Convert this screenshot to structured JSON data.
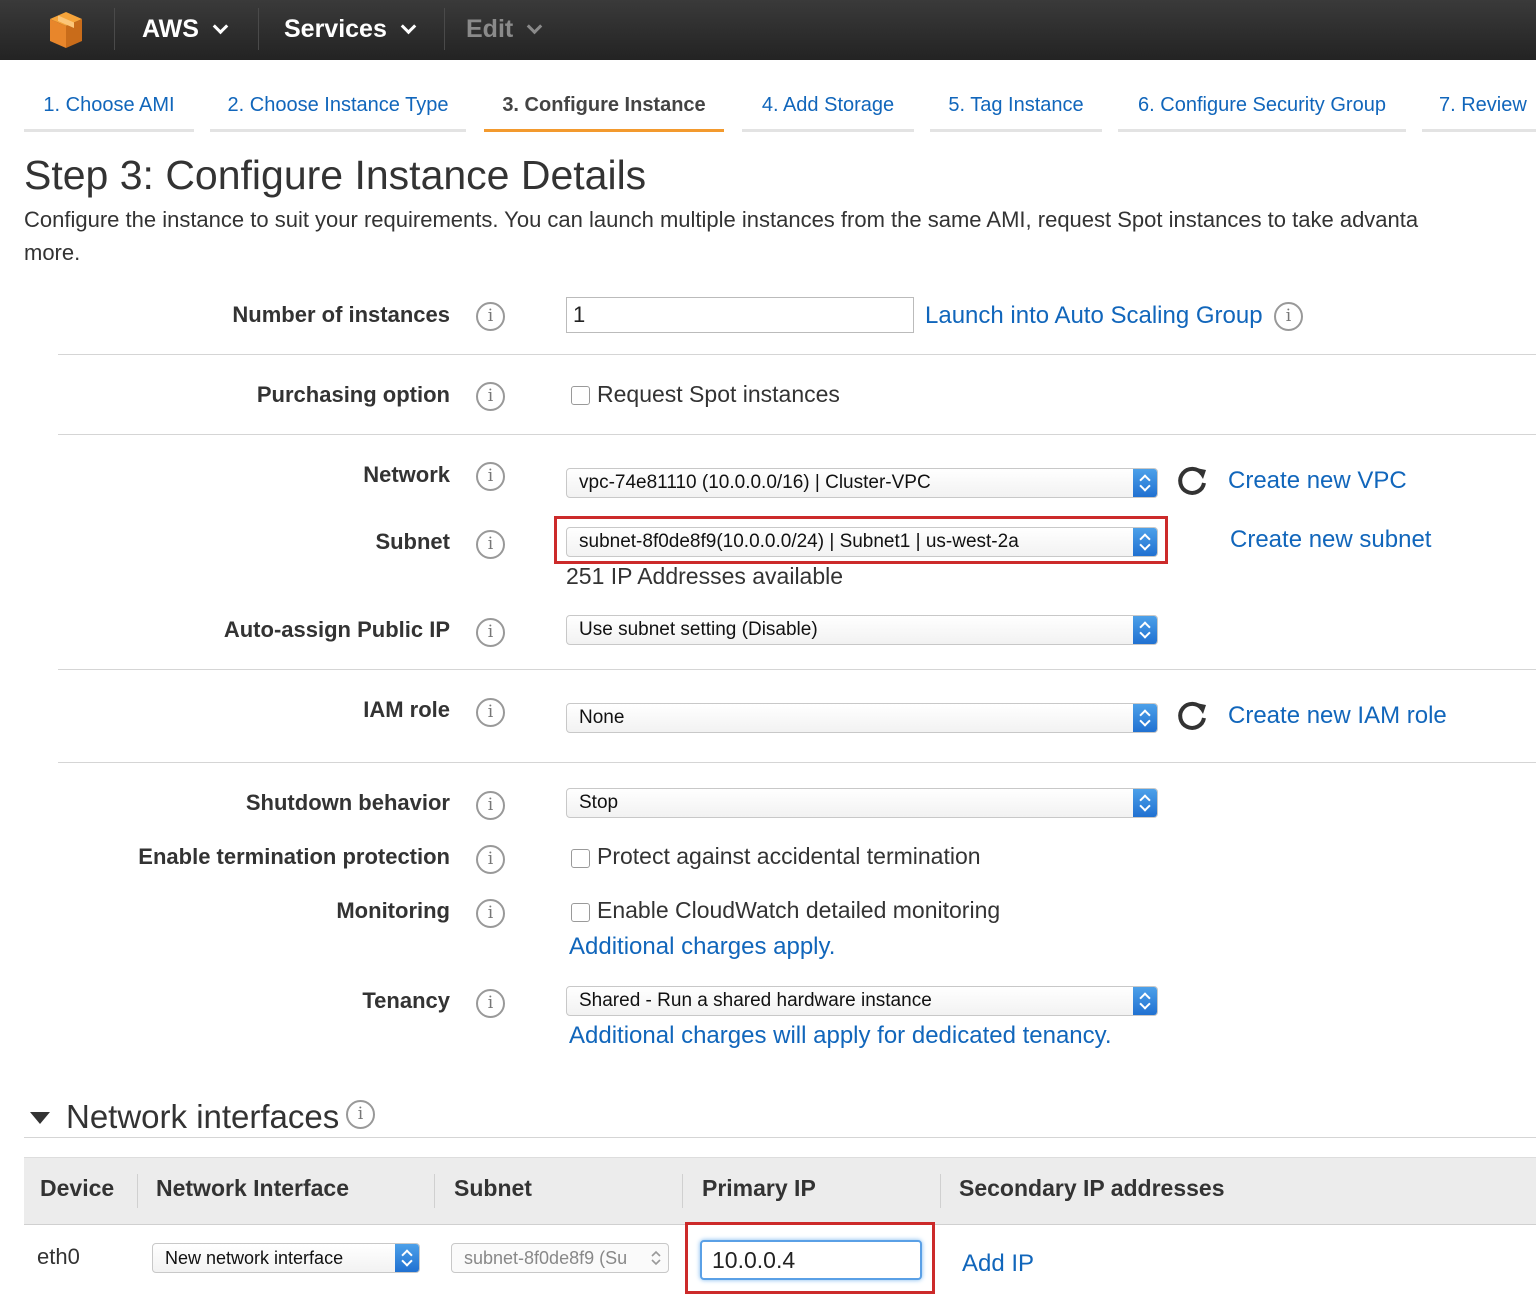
{
  "topnav": {
    "logo_icon": "aws-cube-icon",
    "aws_label": "AWS",
    "services_label": "Services",
    "edit_label": "Edit"
  },
  "wizard_tabs": [
    {
      "label": "1. Choose AMI",
      "active": false
    },
    {
      "label": "2. Choose Instance Type",
      "active": false
    },
    {
      "label": "3. Configure Instance",
      "active": true
    },
    {
      "label": "4. Add Storage",
      "active": false
    },
    {
      "label": "5. Tag Instance",
      "active": false
    },
    {
      "label": "6. Configure Security Group",
      "active": false
    },
    {
      "label": "7. Review",
      "active": false
    }
  ],
  "page": {
    "title": "Step 3: Configure Instance Details",
    "description": "Configure the instance to suit your requirements. You can launch multiple instances from the same AMI, request Spot instances to take advanta",
    "description_cont": "more."
  },
  "form": {
    "instances": {
      "label": "Number of instances",
      "value": "1",
      "asg_link": "Launch into Auto Scaling Group"
    },
    "purchasing": {
      "label": "Purchasing option",
      "checkbox_label": "Request Spot instances",
      "checked": false
    },
    "network": {
      "label": "Network",
      "value": "vpc-74e81110 (10.0.0.0/16) | Cluster-VPC",
      "create_link": "Create new VPC"
    },
    "subnet": {
      "label": "Subnet",
      "value": "subnet-8f0de8f9(10.0.0.0/24) | Subnet1 | us-west-2a",
      "available": "251 IP Addresses available",
      "create_link": "Create new subnet"
    },
    "public_ip": {
      "label": "Auto-assign Public IP",
      "value": "Use subnet setting (Disable)"
    },
    "iam": {
      "label": "IAM role",
      "value": "None",
      "create_link": "Create new IAM role"
    },
    "shutdown": {
      "label": "Shutdown behavior",
      "value": "Stop"
    },
    "termination": {
      "label": "Enable termination protection",
      "checkbox_label": "Protect against accidental termination",
      "checked": false
    },
    "monitoring": {
      "label": "Monitoring",
      "checkbox_label": "Enable CloudWatch detailed monitoring",
      "checked": false,
      "charges_link": "Additional charges apply."
    },
    "tenancy": {
      "label": "Tenancy",
      "value": "Shared - Run a shared hardware instance",
      "charges_link": "Additional charges will apply for dedicated tenancy."
    }
  },
  "network_interfaces": {
    "title": "Network interfaces",
    "columns": [
      "Device",
      "Network Interface",
      "Subnet",
      "Primary IP",
      "Secondary IP addresses"
    ],
    "rows": [
      {
        "device": "eth0",
        "interface": "New network interface",
        "subnet": "subnet-8f0de8f9 (Su",
        "primary_ip": "10.0.0.4",
        "add_ip": "Add IP"
      }
    ]
  },
  "colors": {
    "link": "#1166bb",
    "active_tab_underline": "#f39a2e",
    "highlight_box": "#cc2a2a",
    "select_spinner": "#2f82dc",
    "topbar": "#2b2b2b"
  }
}
